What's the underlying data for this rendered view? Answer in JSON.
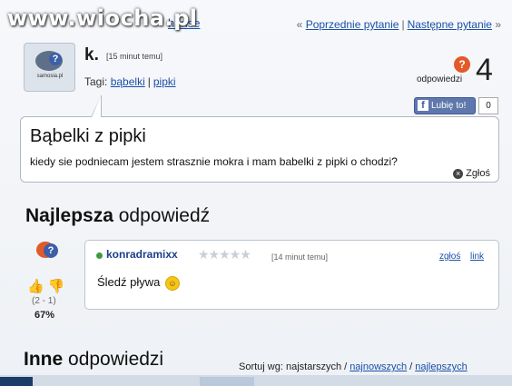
{
  "watermark": "www.wiocha.pl",
  "top_left_link": "hanse",
  "nav": {
    "prev": "Poprzednie pytanie",
    "next": "Następne pytanie",
    "left_chev": "«",
    "right_chev": "»",
    "sep": "|"
  },
  "question": {
    "avatar_text": "samosia.pl",
    "author": "k.",
    "time": "[15 minut temu]",
    "tags_label": "Tagi:",
    "tags": [
      "bąbelki",
      "pipki"
    ],
    "answers_label": "odpowiedzi",
    "answers_count": "4",
    "title": "Bąbelki z pipki",
    "body": "kiedy sie podniecam jestem strasznie mokra i mam babelki z pipki o chodzi?",
    "report": "Zgłoś"
  },
  "like": {
    "label": "Lubię to!",
    "fb_letter": "f",
    "count": "0"
  },
  "best": {
    "heading_bold": "Najlepsza",
    "heading_rest": "odpowiedź",
    "votes": "(2 - 1)",
    "percent": "67%",
    "author": "konradramixx",
    "stars": "★★★★★",
    "time": "[14 minut temu]",
    "report": "zgłoś",
    "link": "link",
    "text": "Śledź pływa"
  },
  "other": {
    "heading_bold": "Inne",
    "heading_rest": "odpowiedzi",
    "sort_label": "Sortuj wg:",
    "sort_oldest": "najstarszych",
    "sort_newest": "najnowszych",
    "sort_best": "najlepszych",
    "sep": "/"
  },
  "colors": {
    "accent": "#1a4fa8",
    "answers_badge": "#e2592a",
    "facebook": "#3b5998",
    "online_dot": "#3e9a3e"
  }
}
